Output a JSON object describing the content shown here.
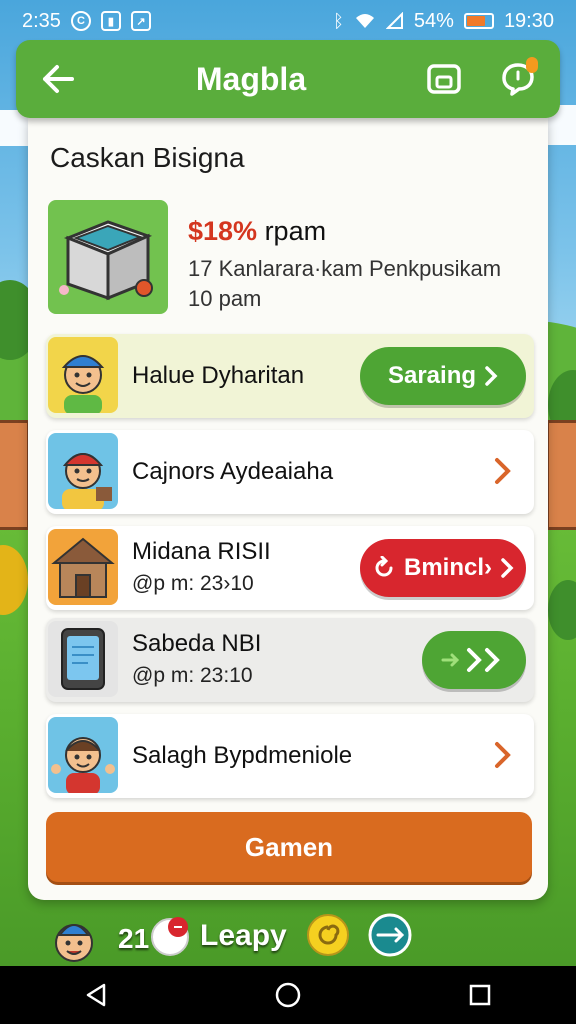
{
  "status_bar": {
    "time_left": "2:35",
    "battery": "54%",
    "time_right": "19:30"
  },
  "app_bar": {
    "title": "Magbla"
  },
  "card": {
    "title": "Caskan Bisigna",
    "featured": {
      "price_highlight": "$18%",
      "price_rest": " rpam",
      "line1": "17 Kanlarara·kam Penkpusikam",
      "line2": "10 pam"
    },
    "rows": [
      {
        "title": "Halue Dyharitan",
        "time": "",
        "action": "Saraing",
        "action_type": "pill-green",
        "icon": "boy-blue-cap-avatar"
      },
      {
        "title": "Cajnors Aydeaiaha",
        "time": "",
        "action": "",
        "action_type": "chevron",
        "icon": "girl-red-hat-avatar"
      },
      {
        "title": "Midana RISII",
        "time": "@p m: 23›10",
        "action": "Bmincl›",
        "action_type": "pill-red",
        "icon": "wooden-house-icon"
      },
      {
        "title": "Sabeda NBI",
        "time": "@p m: 23:10",
        "action": "",
        "action_type": "pill-green-arrows",
        "icon": "tablet-device-icon"
      },
      {
        "title": "Salagh Bypdmeniole",
        "time": "",
        "action": "",
        "action_type": "chevron",
        "icon": "boy-waving-avatar"
      }
    ],
    "primary_button": "Gamen"
  },
  "bottom_bar": {
    "count": "21",
    "label": "Leapy"
  },
  "colors": {
    "app_bar": "#5aad3c",
    "pill_green": "#4ea534",
    "pill_red": "#d8262e",
    "primary_button": "#d96b1f",
    "price_highlight": "#d4361f"
  }
}
